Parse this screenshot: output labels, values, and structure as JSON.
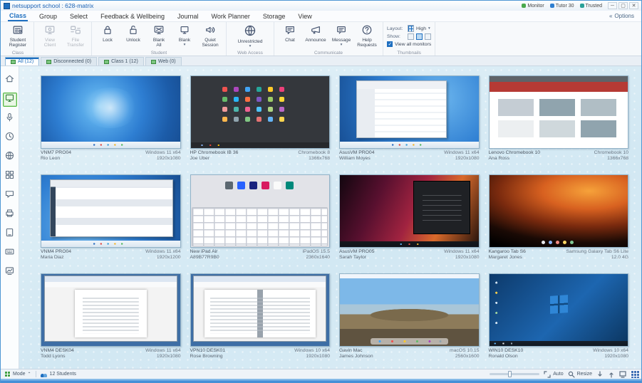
{
  "colors": {
    "accent": "#1e6fc0",
    "active_green": "#58b947",
    "desktop_bg": "#d8eaf5"
  },
  "titlebar": {
    "title": "netsupport school : 628-matrix",
    "status_items": [
      {
        "icon": "green-dot",
        "label": "Monitor"
      },
      {
        "icon": "blue-dot",
        "label": "Tutor 30"
      },
      {
        "icon": "teal-dot",
        "label": "Trusted"
      }
    ],
    "controls": {
      "minimize": "─",
      "maximize": "▢",
      "close": "✕"
    }
  },
  "menubar": {
    "items": [
      "Class",
      "Group",
      "Select",
      "Feedback & Wellbeing",
      "Journal",
      "Work Planner",
      "Storage",
      "View"
    ],
    "active": "Class",
    "right_label": "Options"
  },
  "ribbon": {
    "groups": [
      {
        "label": "Class",
        "items": [
          {
            "label": "Student\nRegister",
            "icon": "register",
            "disabled": false,
            "dropdown": false,
            "big": false
          }
        ]
      },
      {
        "label": "",
        "items": [
          {
            "label": "View\nClient",
            "icon": "view",
            "disabled": true,
            "dropdown": false,
            "big": false
          },
          {
            "label": "File\nTransfer",
            "icon": "transfer",
            "disabled": true,
            "dropdown": false,
            "big": false
          }
        ]
      },
      {
        "label": "Student",
        "items": [
          {
            "label": "Lock",
            "icon": "lock",
            "disabled": false,
            "dropdown": false,
            "big": false
          },
          {
            "label": "Unlock",
            "icon": "unlock",
            "disabled": false,
            "dropdown": false,
            "big": false
          },
          {
            "label": "Blank\nAll",
            "icon": "blankall",
            "disabled": false,
            "dropdown": false,
            "big": false
          },
          {
            "label": "Blank",
            "icon": "blank",
            "disabled": false,
            "dropdown": true,
            "big": false
          },
          {
            "label": "Quiet\nSession",
            "icon": "quiet",
            "disabled": false,
            "dropdown": false,
            "big": false
          }
        ]
      },
      {
        "label": "Web Access",
        "items": [
          {
            "label": "Unrestricted",
            "icon": "globe",
            "disabled": false,
            "dropdown": true,
            "big": true
          }
        ]
      },
      {
        "label": "Communicate",
        "items": [
          {
            "label": "Chat",
            "icon": "chat",
            "disabled": false,
            "dropdown": false,
            "big": false
          },
          {
            "label": "Announce",
            "icon": "announce",
            "disabled": false,
            "dropdown": false,
            "big": false
          },
          {
            "label": "Message",
            "icon": "message",
            "disabled": false,
            "dropdown": true,
            "big": false
          },
          {
            "label": "Help\nRequests",
            "icon": "help",
            "disabled": false,
            "dropdown": false,
            "big": false
          }
        ]
      }
    ],
    "thumbnails_panel": {
      "label": "Thumbnails",
      "layout_label": "Layout:",
      "layout_value": "High",
      "show_label": "Show:",
      "checkbox_label": "View all monitors",
      "checked": true
    }
  },
  "tabs": {
    "items": [
      {
        "label": "All (12)",
        "active": true
      },
      {
        "label": "Disconnected (0)",
        "active": false
      },
      {
        "label": "Class 1 (12)",
        "active": false
      },
      {
        "label": "Web (0)",
        "active": false
      }
    ]
  },
  "sidebar": {
    "items": [
      {
        "name": "home",
        "active": false
      },
      {
        "name": "monitor",
        "active": true
      },
      {
        "name": "audio",
        "active": false
      },
      {
        "name": "clock",
        "active": false
      },
      {
        "name": "globe",
        "active": false
      },
      {
        "name": "apps",
        "active": false
      },
      {
        "name": "chat",
        "active": false
      },
      {
        "name": "printer",
        "active": false
      },
      {
        "name": "device",
        "active": false
      },
      {
        "name": "typing",
        "active": false
      },
      {
        "name": "whiteboard",
        "active": false
      }
    ]
  },
  "students": [
    {
      "machine": "VNM7 PRO04",
      "user": "Rio Leon",
      "os": "Windows 11 x64",
      "res": "1920x1080",
      "variant": "win11"
    },
    {
      "machine": "HP Chromebook IB 36",
      "user": "Joe Uber",
      "os": "Chromebook 8",
      "res": "1366x768",
      "variant": "chromebook"
    },
    {
      "machine": "AsusVM PRO04",
      "user": "William Moyes",
      "os": "Windows 11 x64",
      "res": "1920x1080",
      "variant": "win11-explorer"
    },
    {
      "machine": "Lenovo Chromebook 10",
      "user": "Ana Ross",
      "os": "Chromebook 10",
      "res": "1366x768",
      "variant": "chromeweb"
    },
    {
      "machine": "VNM4 PRO04",
      "user": "Maria Diaz",
      "os": "Windows 11 x64",
      "res": "1920x1200",
      "variant": "win11-browser"
    },
    {
      "machine": "New iPad Air",
      "user": "A89B77R9B0",
      "os": "iPadOS 15.5",
      "res": "2360x1640",
      "variant": "ipad"
    },
    {
      "machine": "AsusVM PRO05",
      "user": "Sarah Taylor",
      "os": "Windows 11 x64",
      "res": "1920x1080",
      "variant": "win11-dark"
    },
    {
      "machine": "Kangaroo Tab S6",
      "user": "Margaret Jones",
      "os": "Samsung Galaxy Tab S6 Lite",
      "res": "12.0 4G",
      "variant": "tab"
    },
    {
      "machine": "VNM4 DESK04",
      "user": "Todd Lyons",
      "os": "Windows 11 x64",
      "res": "1920x1080",
      "variant": "doc"
    },
    {
      "machine": "VPN10 DESK01",
      "user": "Rose Browning",
      "os": "Windows 10 x64",
      "res": "1920x1080",
      "variant": "doc2"
    },
    {
      "machine": "Gavin Mac",
      "user": "James Johnson",
      "os": "macOS 10.15",
      "res": "2560x1600",
      "variant": "macos"
    },
    {
      "machine": "WIN10 DESK10",
      "user": "Ronald Olson",
      "os": "Windows 10 x64",
      "res": "1920x1080",
      "variant": "win10"
    }
  ],
  "statusbar": {
    "left": [
      {
        "icon": "grid",
        "label": "Mode"
      },
      {
        "icon": "students",
        "label": "12 Students"
      }
    ],
    "zoom_auto_label": "Auto",
    "resize_label": "Resize"
  }
}
